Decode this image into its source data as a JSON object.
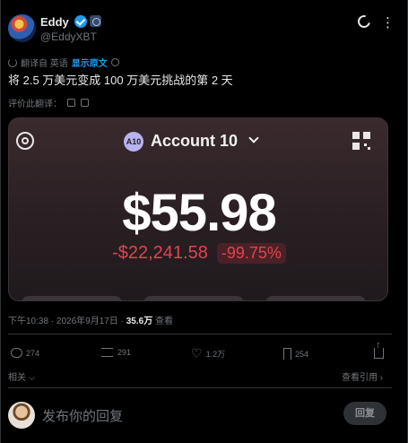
{
  "author": {
    "name": "Eddy",
    "handle": "@EddyXBT",
    "verified": true
  },
  "translation": {
    "label": "翻译自 英语",
    "show_original": "显示原文"
  },
  "tweet": {
    "text": "将 2.5 万美元变成 100 万美元挑战的第 2 天"
  },
  "rate_translation": "评价此翻译：",
  "card": {
    "account_badge": "A10",
    "account_name": "Account 10",
    "balance": "$55.98",
    "pnl_amount": "-$22,241.58",
    "pnl_percent": "-99.75%",
    "negative_color": "#e0454f"
  },
  "meta": {
    "time": "下午10:38 · 2026年9月17日 · ",
    "views_count": "35.6万",
    "views_label": " 查看"
  },
  "actions": {
    "replies": "274",
    "reposts": "291",
    "likes": "1.2万",
    "bookmarks": "254"
  },
  "related_label": "相关",
  "quotes_label": "查看引用",
  "reply": {
    "placeholder": "发布你的回复",
    "button": "回复"
  },
  "colors": {
    "background": "#000000",
    "accent": "#1d9bf0",
    "muted": "#71767b"
  }
}
